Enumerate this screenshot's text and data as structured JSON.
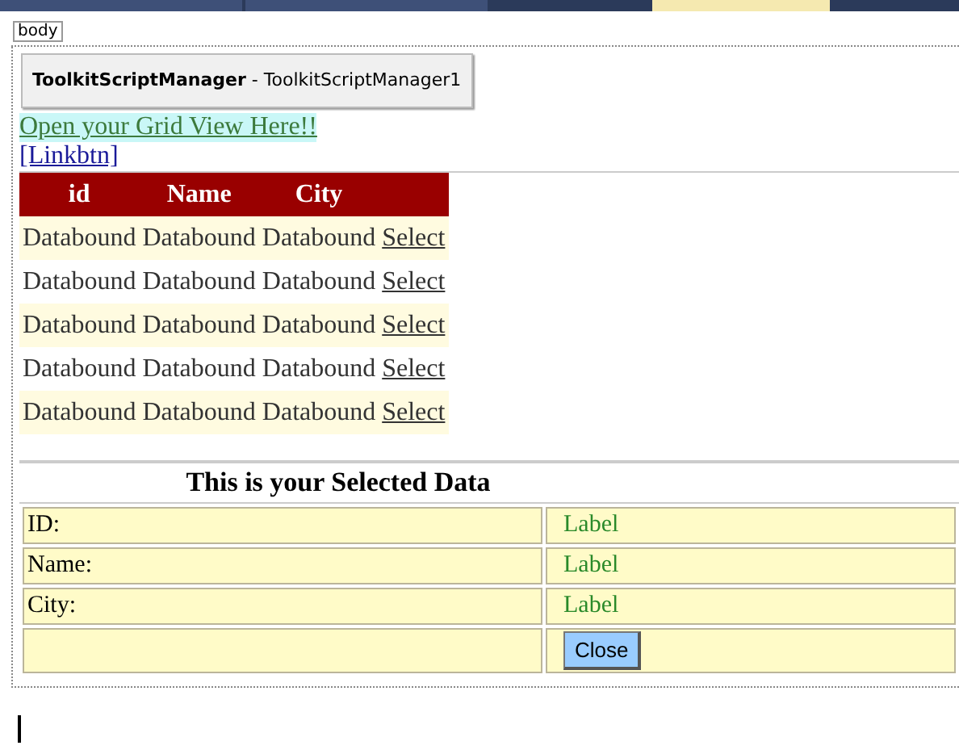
{
  "tabs": [
    {
      "selected": false
    },
    {
      "selected": false
    },
    {
      "selected": true
    }
  ],
  "tag_label": "body",
  "script_manager": {
    "type": "ToolkitScriptManager",
    "separator": " - ",
    "id": "ToolkitScriptManager1"
  },
  "open_link": "Open your Grid View Here!!",
  "link_button": "[Linkbtn]",
  "grid": {
    "columns": [
      "id",
      "Name",
      "City"
    ],
    "rows": [
      {
        "cells": [
          "Databound",
          "Databound",
          "Databound"
        ],
        "action": "Select"
      },
      {
        "cells": [
          "Databound",
          "Databound",
          "Databound"
        ],
        "action": "Select"
      },
      {
        "cells": [
          "Databound",
          "Databound",
          "Databound"
        ],
        "action": "Select"
      },
      {
        "cells": [
          "Databound",
          "Databound",
          "Databound"
        ],
        "action": "Select"
      },
      {
        "cells": [
          "Databound",
          "Databound",
          "Databound"
        ],
        "action": "Select"
      }
    ]
  },
  "details": {
    "heading": "This is your Selected Data",
    "rows": [
      {
        "label": "ID:",
        "value": "Label"
      },
      {
        "label": "Name:",
        "value": "Label"
      },
      {
        "label": " City:",
        "value": "Label"
      }
    ],
    "close_button": "Close"
  }
}
